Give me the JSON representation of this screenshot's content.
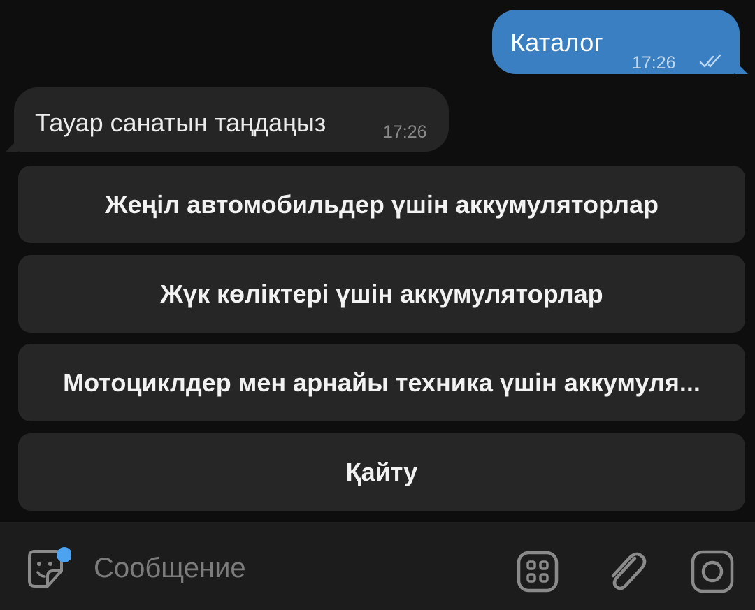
{
  "messages": {
    "outgoing": {
      "text": "Каталог",
      "time": "17:26",
      "status_icon": "double-check-icon"
    },
    "incoming": {
      "text": "Тауар санатын таңдаңыз",
      "time": "17:26"
    }
  },
  "keyboard": {
    "buttons": [
      {
        "label": "Жеңіл автомобильдер үшін аккумуляторлар"
      },
      {
        "label": "Жүк көліктері үшін аккумуляторлар"
      },
      {
        "label": "Мотоциклдер мен арнайы техника үшін аккумуля..."
      },
      {
        "label": "Қайту"
      }
    ]
  },
  "composer": {
    "placeholder": "Сообщение",
    "left_icon": "sticker-icon",
    "right_icons": [
      "bot-keyboard-icon",
      "attach-icon",
      "camera-icon"
    ]
  },
  "colors": {
    "background": "#0e0e0e",
    "outgoing_bubble": "#3a7fc1",
    "incoming_bubble": "#252525",
    "keyboard_button": "#262626",
    "composer_bar": "#1c1c1c",
    "badge_dot": "#4ea3f0"
  }
}
